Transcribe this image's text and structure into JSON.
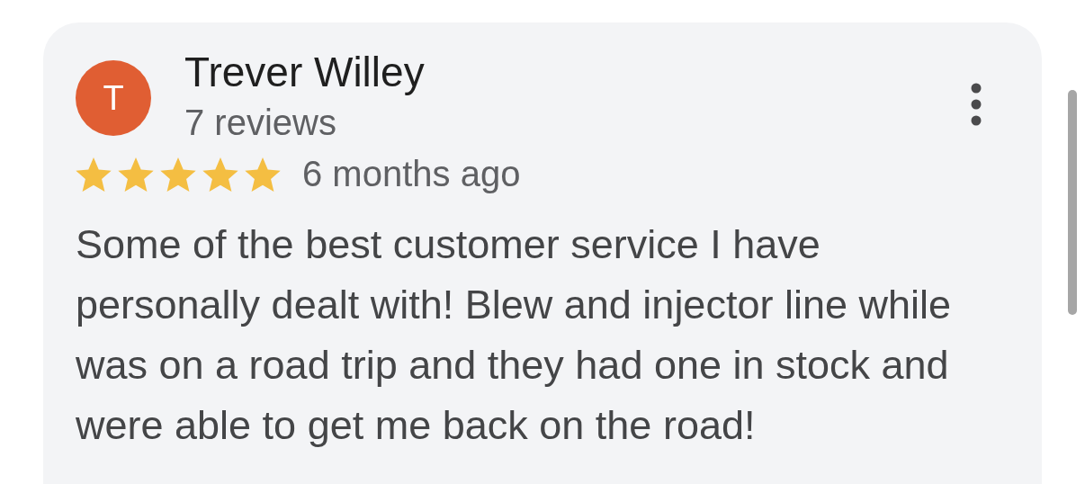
{
  "review": {
    "avatar_initial": "T",
    "author": "Trever Willey",
    "review_count": "7 reviews",
    "stars": 5,
    "time": "6 months ago",
    "text": "Some of the best customer service I have personally dealt with! Blew and injector line while was on a road trip and they had one in stock and were able to get me back on the road!"
  }
}
